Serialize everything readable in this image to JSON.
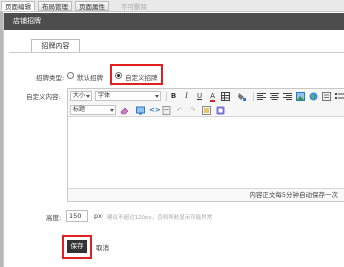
{
  "top_tabs": [
    {
      "label": "页面编辑"
    },
    {
      "label": "布局管理"
    },
    {
      "label": "页面属性"
    },
    {
      "label": "不可删除"
    }
  ],
  "dialog": {
    "title": "店铺招牌",
    "tab_label": "招牌内容",
    "type_label": "招牌类型:",
    "radio_default": "默认招牌",
    "radio_custom": "自定义招牌",
    "custom_content_label": "自定义内容:",
    "editor": {
      "font_size": "大小",
      "font_family": "字体",
      "heading": "标题",
      "autosave_status": "内容正文每5分钟自动保存一次"
    },
    "height_label": "高度:",
    "height_value": "150",
    "height_unit": "px",
    "height_hint": "建议不超过120px，否则导航显示可能异常",
    "save_label": "保存",
    "cancel_label": "取消"
  },
  "colors": {
    "title_bar": "#4d4d4d",
    "highlight": "#e02020",
    "save_button": "#333333"
  }
}
